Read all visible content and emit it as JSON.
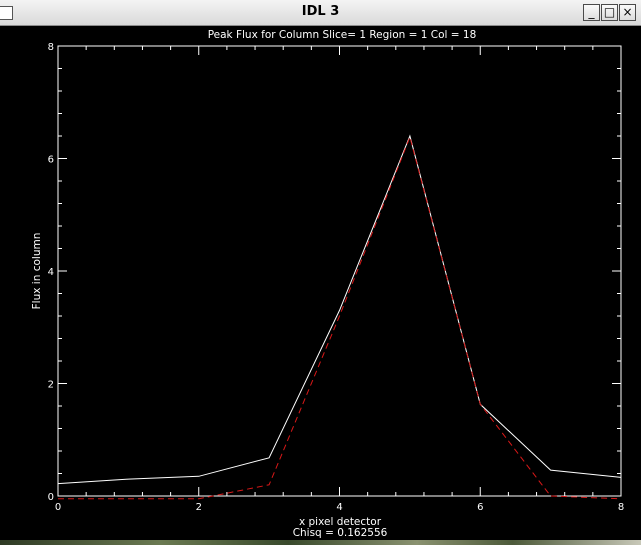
{
  "window": {
    "title": "IDL 3",
    "buttons": {
      "minimize": "_",
      "maximize": "□",
      "close": "×"
    }
  },
  "chart_data": {
    "type": "line",
    "title": "Peak Flux for Column  Slice= 1  Region = 1  Col     = 18",
    "xlabel": "x pixel  detector",
    "ylabel": "Flux in column",
    "annotation": "Chisq = 0.162556",
    "xlim": [
      0,
      8
    ],
    "ylim": [
      0,
      8
    ],
    "x_ticks": [
      "0",
      "2",
      "4",
      "6",
      "8"
    ],
    "y_ticks": [
      "0",
      "2",
      "4",
      "6",
      "8"
    ],
    "background": "#000000",
    "series": [
      {
        "style": "solid",
        "color": "#ffffff",
        "x": [
          0,
          1,
          2,
          3,
          4,
          5,
          6,
          7,
          8
        ],
        "y": [
          0.22,
          0.3,
          0.35,
          0.68,
          3.3,
          6.4,
          1.63,
          0.46,
          0.33
        ]
      },
      {
        "style": "dashed",
        "color": "#d81818",
        "x": [
          0,
          1,
          2,
          3,
          4,
          5,
          6,
          7,
          8
        ],
        "y": [
          -0.05,
          -0.05,
          -0.05,
          0.2,
          3.2,
          6.38,
          1.63,
          0.0,
          -0.05
        ]
      }
    ]
  }
}
